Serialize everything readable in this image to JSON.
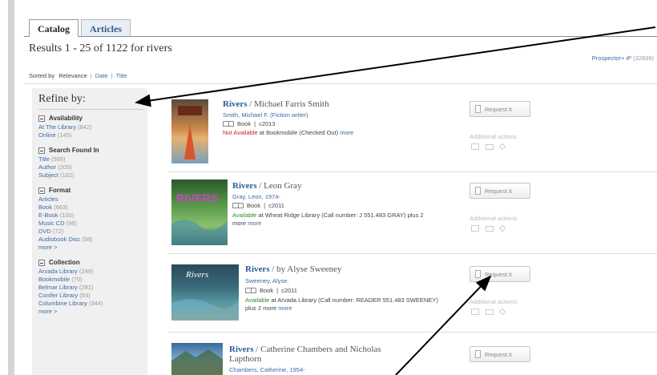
{
  "tabs": [
    {
      "label": "Catalog",
      "active": true
    },
    {
      "label": "Articles",
      "active": false
    }
  ],
  "results_summary": "Results 1 - 25 of 1122 for rivers",
  "prospector": {
    "label": "Prospector+ iP",
    "count": "(32839)"
  },
  "sort": {
    "prefix": "Sorted by",
    "current": "Relevance",
    "options": [
      "Date",
      "Title"
    ]
  },
  "refine": {
    "title": "Refine by:",
    "facets": [
      {
        "heading": "Availability",
        "items": [
          {
            "label": "At The Library",
            "count": "(842)"
          },
          {
            "label": "Online",
            "count": "(145)"
          }
        ]
      },
      {
        "heading": "Search Found In",
        "items": [
          {
            "label": "Title",
            "count": "(566)"
          },
          {
            "label": "Author",
            "count": "(205)"
          },
          {
            "label": "Subject",
            "count": "(182)"
          }
        ]
      },
      {
        "heading": "Format",
        "items": [
          {
            "label": "Articles",
            "count": ""
          },
          {
            "label": "Book",
            "count": "(663)"
          },
          {
            "label": "E-Book",
            "count": "(100)"
          },
          {
            "label": "Music CD",
            "count": "(98)"
          },
          {
            "label": "DVD",
            "count": "(72)"
          },
          {
            "label": "Audiobook Disc",
            "count": "(58)"
          }
        ],
        "more": "more  >"
      },
      {
        "heading": "Collection",
        "items": [
          {
            "label": "Arvada Library",
            "count": "(249)"
          },
          {
            "label": "Bookmobile",
            "count": "(70)"
          },
          {
            "label": "Belmar Library",
            "count": "(281)"
          },
          {
            "label": "Conifer Library",
            "count": "(93)"
          },
          {
            "label": "Columbine Library",
            "count": "(344)"
          }
        ],
        "more": "more  >"
      }
    ]
  },
  "results": [
    {
      "title": "Rivers",
      "responsibility": " / Michael Farris Smith",
      "author": "Smith, Michael F. (Fiction writer)",
      "format": "Book",
      "year": "c2013",
      "status": "Not Available",
      "status_type": "na",
      "availability_text": " at Bookmobile (Checked Out)",
      "more": "more",
      "cover_label": "RIVERS"
    },
    {
      "title": "Rivers",
      "responsibility": " / Leon Gray",
      "author": "Gray, Leon, 1974-",
      "format": "Book",
      "year": "c2011",
      "status": "Available",
      "status_type": "ok",
      "availability_text": " at Wheat Ridge Library (Call number: J 551.483 GRAY) plus 2 more",
      "more": "more",
      "cover_label": "RIVERS"
    },
    {
      "title": "Rivers",
      "responsibility": " / by Alyse Sweeney",
      "author": "Sweeney, Alyse.",
      "format": "Book",
      "year": "c2011",
      "status": "Available",
      "status_type": "ok",
      "availability_text": " at Arvada Library (Call number: READER 551.483 SWEENEY) plus 2 more",
      "more": "more",
      "cover_label": "Rivers"
    },
    {
      "title": "Rivers",
      "responsibility": " / Catherine Chambers and Nicholas",
      "responsibility_line2": "Lapthorn",
      "author": "Chambers, Catherine, 1954-"
    }
  ],
  "actions": {
    "request_label": "Request it",
    "additional_label": "Additional actions:"
  },
  "colors": {
    "link": "#3a6aa8",
    "title": "#2d5a9a",
    "available": "#2e8b2e",
    "not_available": "#cc2222",
    "sidebar_bg": "#f0f0f0"
  }
}
